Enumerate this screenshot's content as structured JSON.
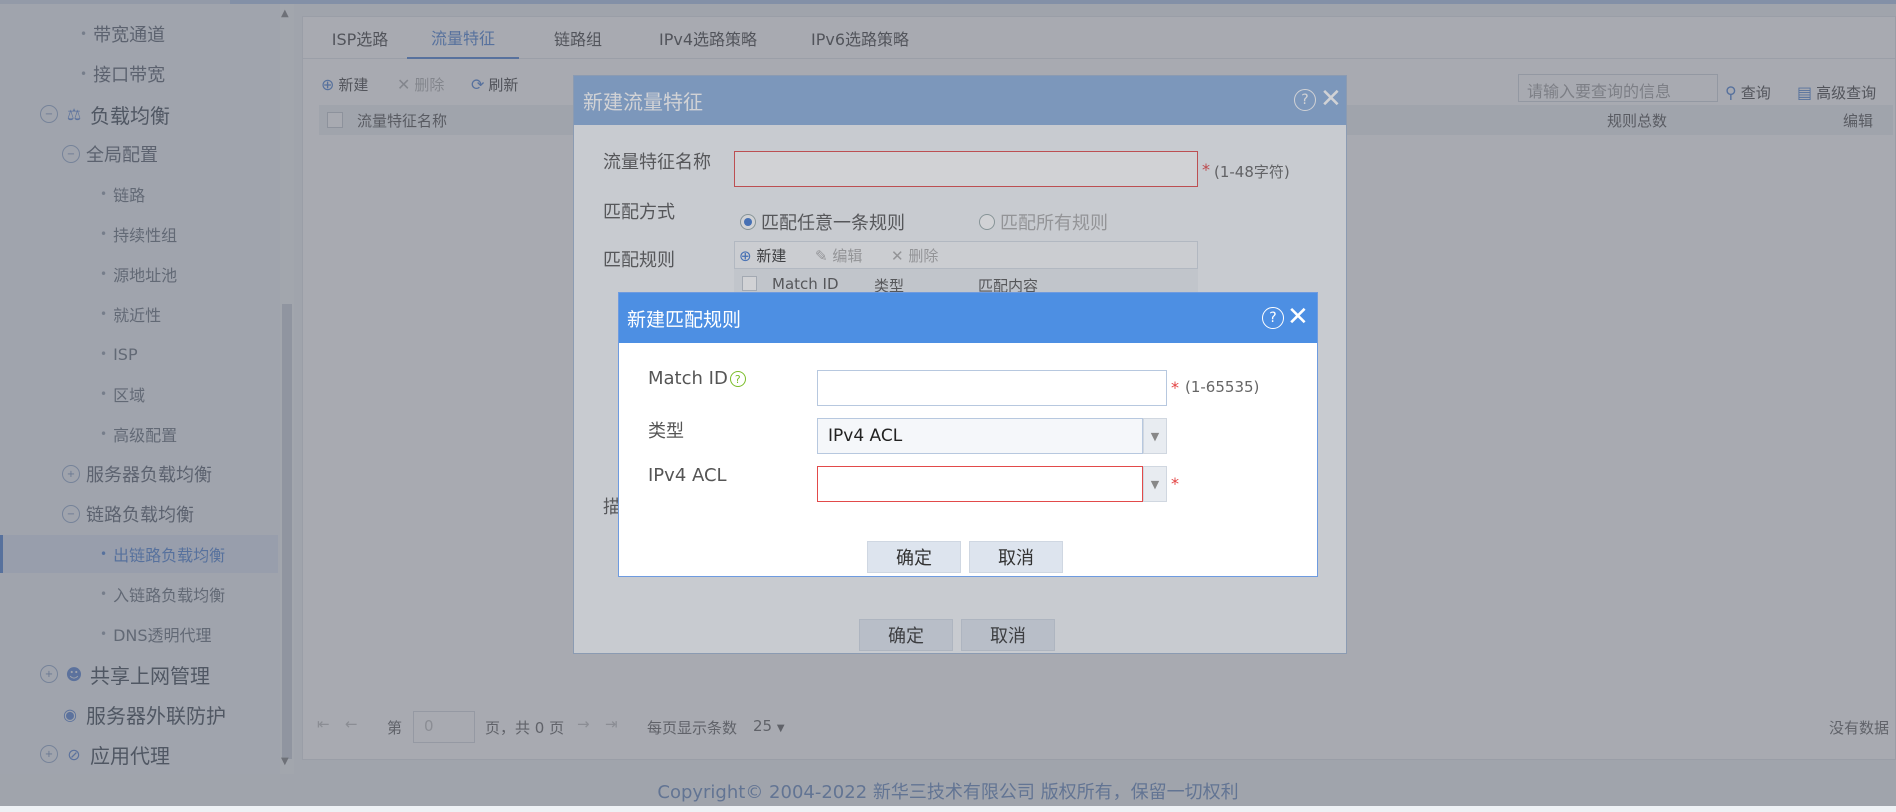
{
  "sidebar": {
    "items": [
      {
        "label": "带宽通道"
      },
      {
        "label": "接口带宽"
      },
      {
        "label": "负载均衡"
      },
      {
        "label": "全局配置"
      },
      {
        "label": "链路"
      },
      {
        "label": "持续性组"
      },
      {
        "label": "源地址池"
      },
      {
        "label": "就近性"
      },
      {
        "label": "ISP"
      },
      {
        "label": "区域"
      },
      {
        "label": "高级配置"
      },
      {
        "label": "服务器负载均衡"
      },
      {
        "label": "链路负载均衡"
      },
      {
        "label": "出链路负载均衡"
      },
      {
        "label": "入链路负载均衡"
      },
      {
        "label": "DNS透明代理"
      },
      {
        "label": "共享上网管理"
      },
      {
        "label": "服务器外联防护"
      },
      {
        "label": "应用代理"
      }
    ]
  },
  "tabs": [
    "ISP选路",
    "流量特征",
    "链路组",
    "IPv4选路策略",
    "IPv6选路策略"
  ],
  "toolbar": {
    "new_label": "新建",
    "delete_label": "删除",
    "refresh_label": "刷新",
    "search_placeholder": "请输入要查询的信息",
    "query_label": "查询",
    "advanced_query_label": "高级查询"
  },
  "grid": {
    "columns": [
      "流量特征名称",
      "规则总数",
      "编辑"
    ]
  },
  "pager": {
    "page_prefix": "第",
    "page_value": "0",
    "page_suffix": "页，共 0 页",
    "per_page_label": "每页显示条数",
    "per_page_value": "25",
    "no_data": "没有数据"
  },
  "dialog_feature": {
    "title": "新建流量特征",
    "name_label": "流量特征名称",
    "name_hint": "(1-48字符)",
    "match_mode_label": "匹配方式",
    "radio_any": "匹配任意一条规则",
    "radio_all": "匹配所有规则",
    "match_rules_label": "匹配规则",
    "rules_toolbar": {
      "new": "新建",
      "edit": "编辑",
      "delete": "删除"
    },
    "rules_columns": [
      "Match ID",
      "类型",
      "匹配内容"
    ],
    "desc_label_partial": "描",
    "ok_label": "确定",
    "cancel_label": "取消"
  },
  "dialog_rule": {
    "title": "新建匹配规则",
    "match_id_label": "Match ID",
    "match_id_hint": "(1-65535)",
    "type_label": "类型",
    "type_value": "IPv4 ACL",
    "acl_label": "IPv4 ACL",
    "ok_label": "确定",
    "cancel_label": "取消"
  },
  "footer": {
    "copyright": "Copyright© 2004-2022 新华三技术有限公司 版权所有，保留一切权利"
  },
  "colors": {
    "accent": "#3f78d1",
    "dialog_header": "#4d8fe3",
    "required": "#e34141"
  }
}
